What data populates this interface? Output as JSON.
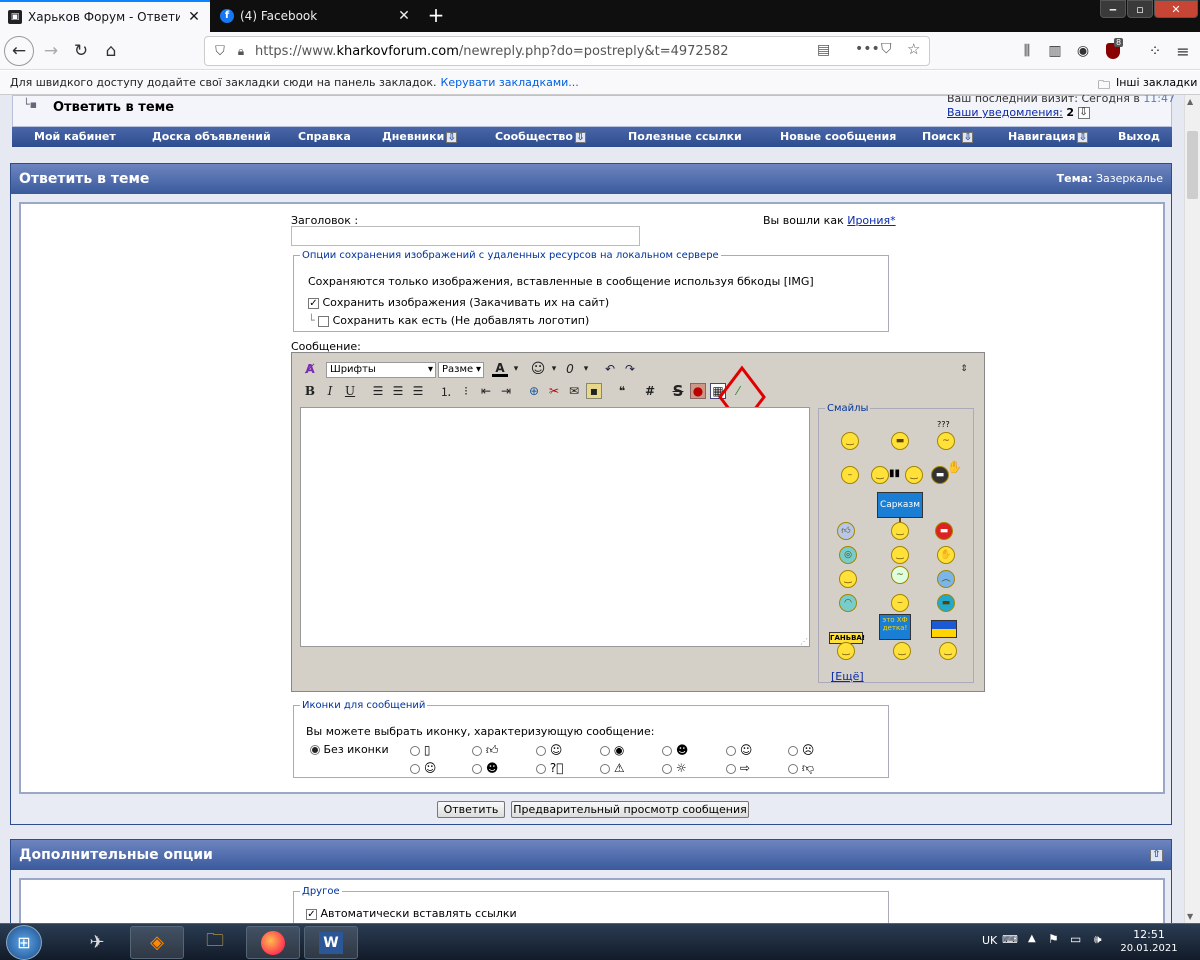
{
  "browser": {
    "tabs": [
      {
        "label": "Харьков Форум - Ответить в т",
        "active": true
      },
      {
        "label": "(4) Facebook",
        "active": false
      }
    ],
    "url_prefix": "https://www.",
    "url_domain": "kharkovforum.com",
    "url_path": "/newreply.php?do=postreply&t=4972582",
    "bookmarks_hint": "Для швидкого доступу додайте свої закладки сюди на панель закладок.",
    "bookmarks_manage": "Керувати закладками...",
    "other_bookmarks": "Інші закладки",
    "addon_badge": "8"
  },
  "header": {
    "breadcrumb_current": "Ответить в теме",
    "last_visit_label": "Ваш последний визит:",
    "last_visit_value": "Сегодня в",
    "last_visit_time": "11:47",
    "notifications_label": "Ваши уведомления:",
    "notifications_count": "2"
  },
  "nav": [
    {
      "label": "Мой кабинет",
      "dropdown": false
    },
    {
      "label": "Доска объявлений",
      "dropdown": false
    },
    {
      "label": "Справка",
      "dropdown": false
    },
    {
      "label": "Дневники",
      "dropdown": true
    },
    {
      "label": "Сообщество",
      "dropdown": true
    },
    {
      "label": "Полезные ссылки",
      "dropdown": false
    },
    {
      "label": "Новые сообщения",
      "dropdown": false
    },
    {
      "label": "Поиск",
      "dropdown": true
    },
    {
      "label": "Навигация",
      "dropdown": true
    },
    {
      "label": "Выход",
      "dropdown": false
    }
  ],
  "reply": {
    "title": "Ответить в теме",
    "topic_label": "Тема:",
    "topic_value": "Зазеркалье",
    "subject_label": "Заголовок :",
    "subject_value": "",
    "logged_in_label": "Вы вошли как",
    "username": "Ирония*",
    "image_options": {
      "legend": "Опции сохранения изображений с удаленных ресурсов на локальном сервере",
      "note": "Сохраняются только изображения, вставленные в сообщение используя ббкоды [IMG]",
      "save_images": "Сохранить изображения (Закачивать их на сайт)",
      "save_images_checked": true,
      "keep_as_is": "Сохранить как есть (Не добавлять логотип)",
      "keep_as_is_checked": false
    },
    "message_label": "Сообщение:",
    "editor": {
      "font_select": "Шрифты",
      "size_select": "Разме",
      "message_value": ""
    },
    "smilies": {
      "legend": "Смайлы",
      "more_link": "[Ещё]",
      "sign_sarcasm": "Сарказм",
      "sign_ganja": "ГАНЬВА!",
      "sign_xf": "это ХФ детка!",
      "question_marks": "???"
    },
    "post_icons": {
      "legend": "Иконки для сообщений",
      "hint": "Вы можете выбрать иконку, характеризующую сообщение:",
      "no_icon": "Без иконки"
    },
    "submit_label": "Ответить",
    "preview_label": "Предварительный просмотр сообщения"
  },
  "extra": {
    "title": "Дополнительные опции",
    "other_legend": "Другое",
    "auto_links": "Автоматически вставлять ссылки",
    "auto_links_checked": true
  },
  "taskbar": {
    "language": "UK",
    "time": "12:51",
    "date": "20.01.2021"
  },
  "colors": {
    "forum_blue": "#2d4d8e",
    "annotation_red": "#e00000",
    "link": "#0a2aa8"
  }
}
